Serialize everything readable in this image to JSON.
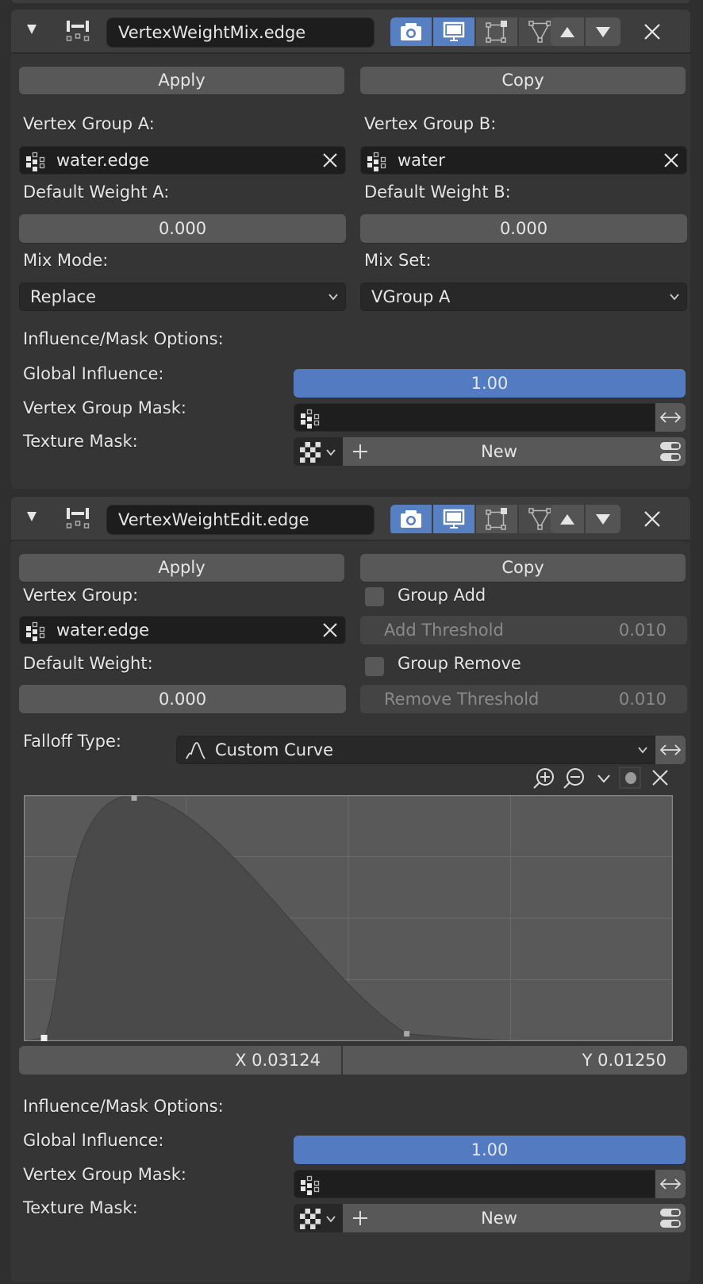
{
  "modifiers": [
    {
      "name": "VertexWeightMix.edge",
      "icon": "modifier-vertex-weight-icon",
      "toggles": [
        {
          "id": "render",
          "icon": "camera-icon",
          "active": true
        },
        {
          "id": "viewport",
          "icon": "monitor-icon",
          "active": true
        },
        {
          "id": "edit_mode",
          "icon": "edit-mode-icon",
          "active": false
        },
        {
          "id": "on_cage",
          "icon": "cage-triangle-icon",
          "active": false
        }
      ],
      "apply_label": "Apply",
      "copy_label": "Copy",
      "vertex_group_a_label": "Vertex Group A:",
      "vertex_group_a": "water.edge",
      "vertex_group_b_label": "Vertex Group B:",
      "vertex_group_b": "water",
      "default_weight_a_label": "Default Weight A:",
      "default_weight_a": "0.000",
      "default_weight_b_label": "Default Weight B:",
      "default_weight_b": "0.000",
      "mix_mode_label": "Mix Mode:",
      "mix_mode": "Replace",
      "mix_set_label": "Mix Set:",
      "mix_set": "VGroup A",
      "influence_header": "Influence/Mask Options:",
      "global_influence_label": "Global Influence:",
      "global_influence": "1.00",
      "vertex_group_mask_label": "Vertex Group Mask:",
      "vertex_group_mask": "",
      "texture_mask_label": "Texture Mask:",
      "texture_new_label": "New"
    },
    {
      "name": "VertexWeightEdit.edge",
      "icon": "modifier-vertex-weight-icon",
      "toggles": [
        {
          "id": "render",
          "icon": "camera-icon",
          "active": true
        },
        {
          "id": "viewport",
          "icon": "monitor-icon",
          "active": true
        },
        {
          "id": "edit_mode",
          "icon": "edit-mode-icon",
          "active": false
        },
        {
          "id": "on_cage",
          "icon": "cage-triangle-icon",
          "active": false
        }
      ],
      "apply_label": "Apply",
      "copy_label": "Copy",
      "vertex_group_label": "Vertex Group:",
      "vertex_group": "water.edge",
      "default_weight_label": "Default Weight:",
      "default_weight": "0.000",
      "group_add_label": "Group Add",
      "group_add_checked": false,
      "add_threshold_label": "Add Threshold",
      "add_threshold": "0.010",
      "group_remove_label": "Group Remove",
      "group_remove_checked": false,
      "remove_threshold_label": "Remove Threshold",
      "remove_threshold": "0.010",
      "falloff_type_label": "Falloff Type:",
      "falloff_type": "Custom Curve",
      "curve": {
        "points": [
          [
            0.03124,
            0.0125
          ],
          [
            0.17,
            1.0
          ],
          [
            0.59,
            0.03
          ]
        ],
        "selected_point": 0,
        "x_readout": "X 0.03124",
        "y_readout": "Y 0.01250"
      },
      "influence_header": "Influence/Mask Options:",
      "global_influence_label": "Global Influence:",
      "global_influence": "1.00",
      "vertex_group_mask_label": "Vertex Group Mask:",
      "vertex_group_mask": "",
      "texture_mask_label": "Texture Mask:",
      "texture_new_label": "New"
    }
  ],
  "colors": {
    "accent": "#537bc2",
    "panel": "#353535",
    "header": "#3d3d3d",
    "field_dark": "#1e1e1e",
    "button": "#585858"
  }
}
